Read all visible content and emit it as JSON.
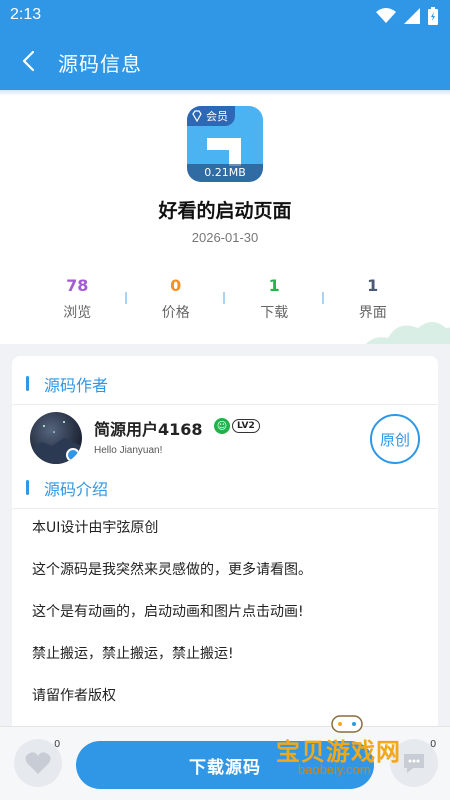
{
  "status_bar": {
    "time": "2:13"
  },
  "app_bar": {
    "title": "源码信息"
  },
  "source": {
    "member_badge": "会员",
    "size": "0.21MB",
    "title": "好看的启动页面",
    "date": "2026-01-30",
    "stats": [
      {
        "value": "78",
        "label": "浏览",
        "color": "#a35bd1"
      },
      {
        "value": "0",
        "label": "价格",
        "color": "#f0922b"
      },
      {
        "value": "1",
        "label": "下载",
        "color": "#2cb24a"
      },
      {
        "value": "1",
        "label": "界面",
        "color": "#4a5a78"
      }
    ]
  },
  "author_section": {
    "heading": "源码作者",
    "name": "简源用户4168",
    "level": "LV2",
    "signature": "Hello Jianyuan!",
    "original_button": "原创"
  },
  "intro_section": {
    "heading": "源码介绍",
    "paragraphs": [
      "本UI设计由宇弦原创",
      "这个源码是我突然来灵感做的，更多请看图。",
      "这个是有动画的，启动动画和图片点击动画!",
      "禁止搬运，禁止搬运，禁止搬运!",
      "请留作者版权"
    ]
  },
  "bottom_bar": {
    "like_count": "0",
    "download_label": "下载源码",
    "comment_count": "0"
  },
  "watermark": {
    "text": "宝贝游戏网",
    "url": "baobeiy.com"
  },
  "colors": {
    "primary": "#2f97e6",
    "background": "#f1f2f5"
  },
  "icons": [
    "wifi-icon",
    "signal-icon",
    "battery-icon",
    "back-arrow-icon",
    "diamond-icon",
    "heart-icon",
    "chat-icon"
  ]
}
